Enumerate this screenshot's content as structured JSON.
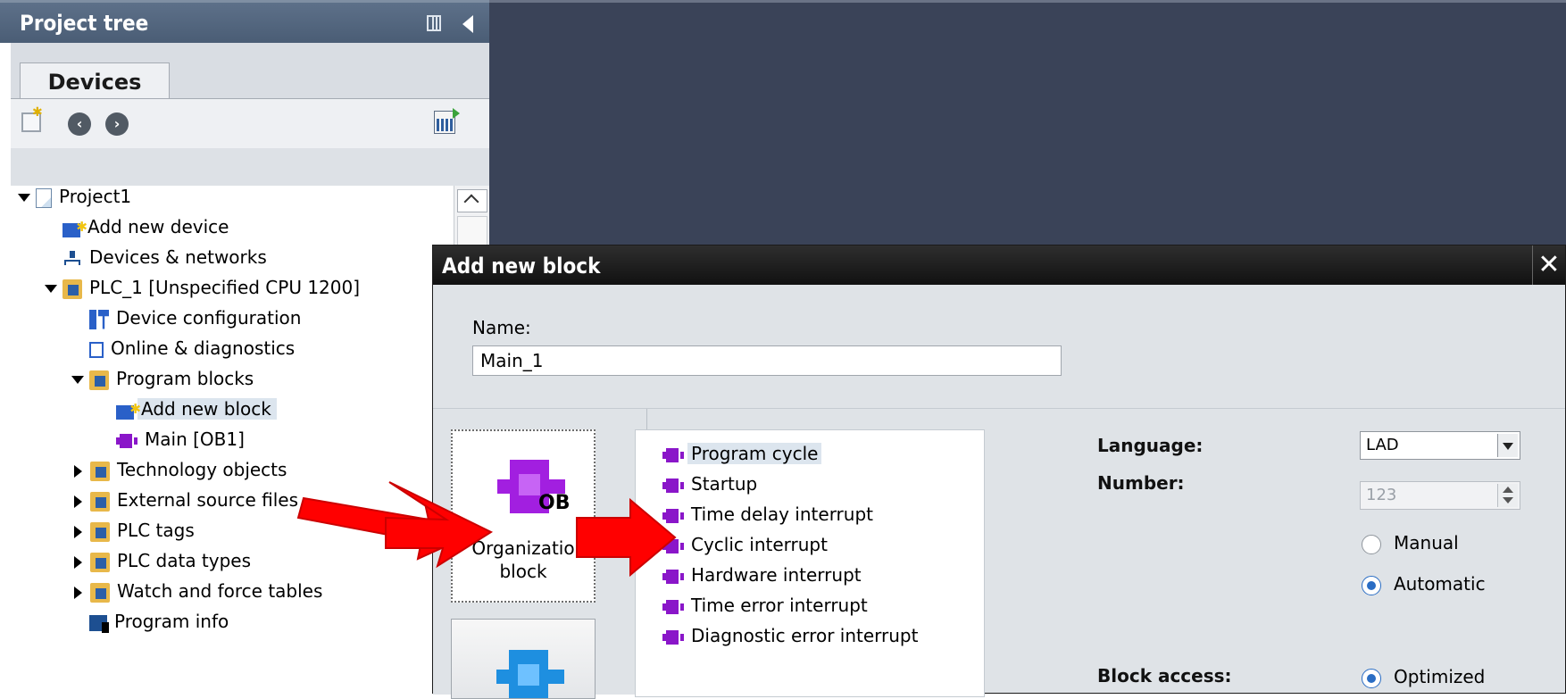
{
  "project_tree": {
    "title": "Project tree",
    "tab": "Devices",
    "items": [
      {
        "label": "Project1",
        "icon": "project-icon",
        "expanded": true
      },
      {
        "label": "Add new device",
        "icon": "add-device-icon"
      },
      {
        "label": "Devices & networks",
        "icon": "network-icon"
      },
      {
        "label": "PLC_1 [Unspecified CPU 1200]",
        "icon": "plc-icon",
        "expanded": true
      },
      {
        "label": "Device configuration",
        "icon": "device-config-icon"
      },
      {
        "label": "Online & diagnostics",
        "icon": "diagnostics-icon"
      },
      {
        "label": "Program blocks",
        "icon": "folder-icon",
        "expanded": true
      },
      {
        "label": "Add new block",
        "icon": "add-block-icon",
        "selected": true
      },
      {
        "label": "Main [OB1]",
        "icon": "ob-block-icon"
      },
      {
        "label": "Technology objects",
        "icon": "folder-icon",
        "expanded": false
      },
      {
        "label": "External source files",
        "icon": "folder-icon",
        "expanded": false
      },
      {
        "label": "PLC tags",
        "icon": "folder-icon",
        "expanded": false
      },
      {
        "label": "PLC data types",
        "icon": "folder-icon",
        "expanded": false
      },
      {
        "label": "Watch and force tables",
        "icon": "folder-icon",
        "expanded": false
      },
      {
        "label": "Program info",
        "icon": "program-info-icon"
      }
    ]
  },
  "dialog": {
    "title": "Add new block",
    "close_label": "✕",
    "name_label": "Name:",
    "name_value": "Main_1",
    "block_types": {
      "ob": {
        "icon_text": "OB",
        "label": "Organization block",
        "label_line1": "Organizatio",
        "label_line2": "block"
      }
    },
    "ob_types": [
      {
        "label": "Program cycle",
        "selected": true
      },
      {
        "label": "Startup"
      },
      {
        "label": "Time delay interrupt"
      },
      {
        "label": "Cyclic interrupt"
      },
      {
        "label": "Hardware interrupt"
      },
      {
        "label": "Time error interrupt"
      },
      {
        "label": "Diagnostic error interrupt"
      }
    ],
    "language_label": "Language:",
    "language_value": "LAD",
    "number_label": "Number:",
    "number_value": "123",
    "number_mode": [
      {
        "label": "Manual",
        "checked": false
      },
      {
        "label": "Automatic",
        "checked": true
      }
    ],
    "block_access_label": "Block access:",
    "block_access_option": {
      "label": "Optimized",
      "checked": true
    }
  },
  "colors": {
    "arrow": "#ff0000",
    "ob_purple": "#a21fe0",
    "fb_blue": "#1e8fe0",
    "panel_header": "#4a5d75",
    "workarea": "#3a4358"
  }
}
